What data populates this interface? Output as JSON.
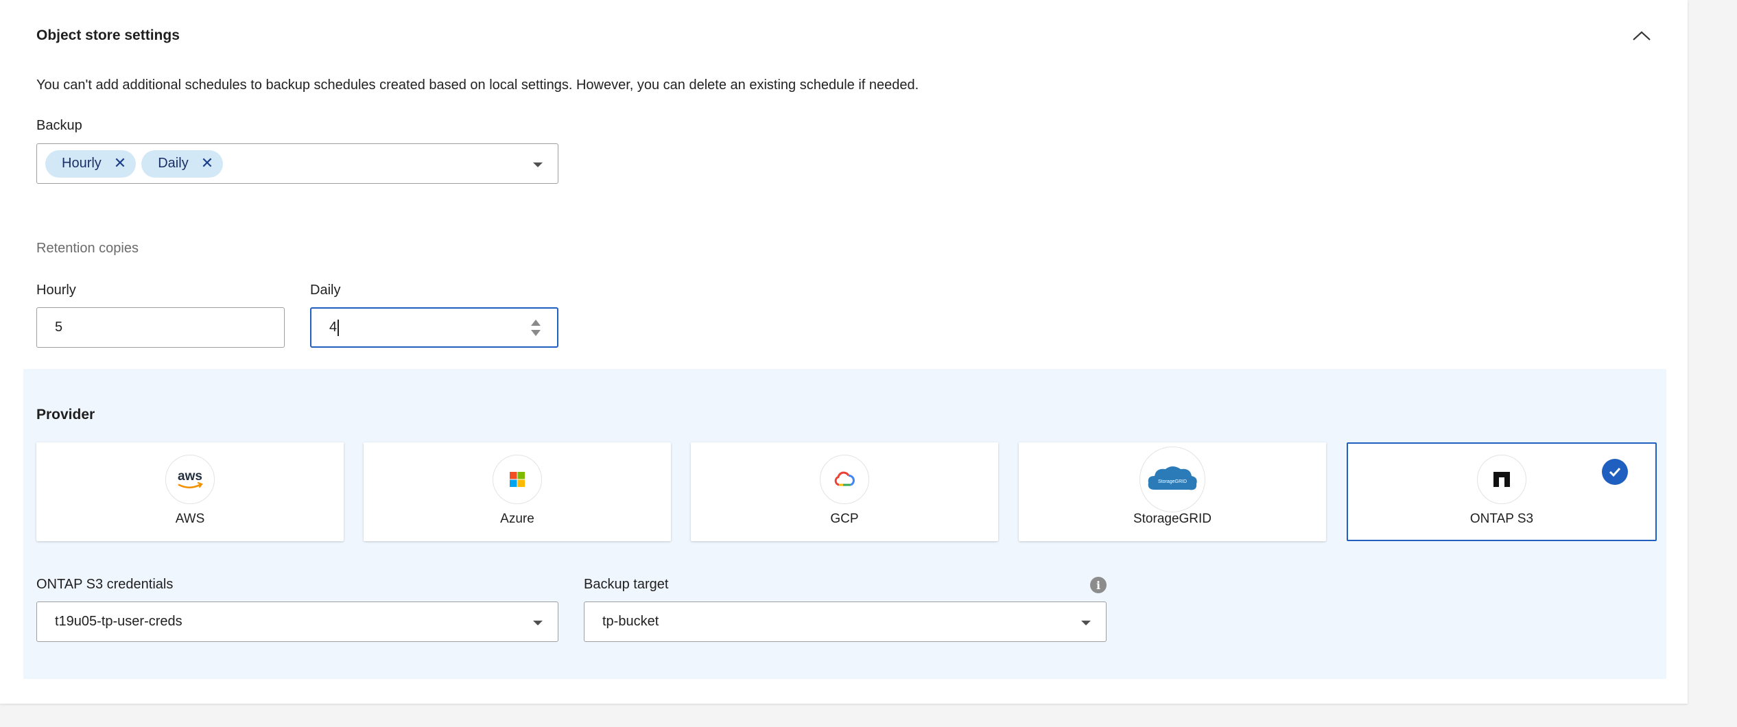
{
  "section": {
    "title": "Object store settings",
    "info": "You can't add additional schedules to backup schedules created based on local settings. However, you can delete an existing schedule if needed."
  },
  "backup": {
    "label": "Backup",
    "chips": [
      "Hourly",
      "Daily"
    ],
    "chip_remove": "✕"
  },
  "retention": {
    "label": "Retention copies",
    "hourly_label": "Hourly",
    "hourly_value": "5",
    "daily_label": "Daily",
    "daily_value": "4"
  },
  "provider": {
    "title": "Provider",
    "options": [
      {
        "label": "AWS",
        "icon": "aws-logo-icon"
      },
      {
        "label": "Azure",
        "icon": "azure-logo-icon"
      },
      {
        "label": "GCP",
        "icon": "gcp-logo-icon"
      },
      {
        "label": "StorageGRID",
        "icon": "storagegrid-logo-icon"
      },
      {
        "label": "ONTAP S3",
        "icon": "ontap-logo-icon"
      }
    ],
    "selected": "ONTAP S3"
  },
  "credentials": {
    "label": "ONTAP S3 credentials",
    "value": "t19u05-tp-user-creds"
  },
  "backup_target": {
    "label": "Backup target",
    "value": "tp-bucket"
  },
  "logo_text": {
    "aws": "aws",
    "storagegrid": "StorageGRID"
  },
  "colors": {
    "accent": "#1f5fbf",
    "chip_bg": "#d3e8f6",
    "provider_bg": "#f0f6fd"
  }
}
